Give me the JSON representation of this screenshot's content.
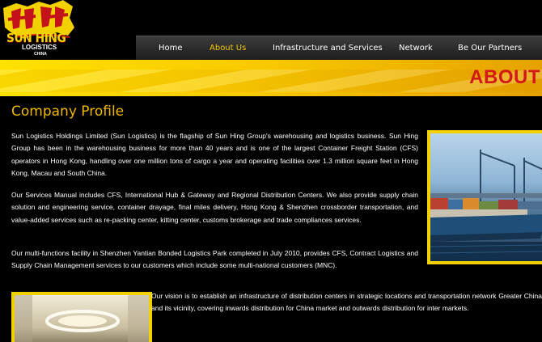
{
  "logo": {
    "chinese": "新興",
    "title": "SUN HING",
    "subtitle": "LOGISTICS",
    "subtitle2": "CHINA"
  },
  "nav": {
    "items": [
      {
        "label": "Home"
      },
      {
        "label": "About Us",
        "active": true
      },
      {
        "label": "Infrastructure and Services"
      },
      {
        "label": "Network"
      },
      {
        "label": "Be Our Partners"
      }
    ]
  },
  "banner": {
    "text": "ABOUT"
  },
  "page": {
    "title": "Company Profile",
    "paragraphs": [
      "Sun Logistics Holdings Limited (Sun Logistics) is the flagship of Sun Hing Group's warehousing and logistics business. Sun Hing Group has been in the warehousing business for more than 40 years and is one of the largest Container Freight Station (CFS) operators in Hong Kong, handling over one million tons of cargo a year and operating facilities over 1.3 million square feet in Hong Kong, Macau and South China.",
      "Our Services Manual includes CFS, International Hub & Gateway and Regional Distribution Centers. We also provide supply chain solution and engineering service, container drayage, final miles delivery, Hong Kong & Shenzhen crossborder transportation, and value-added services such as re-packing center, kitting center, customs brokerage and trade compliances services.",
      "Our multi-functions facility in Shenzhen Yantian Bonded Logistics Park completed in July 2010, provides CFS, Contract Logistics and Supply Chain Management services to our customers which include some multi-national customers (MNC).",
      "Our vision is to establish an infrastructure of distribution centers in strategic locations and transportation network Greater China and its vicinity, covering inwards distribution for China market and outwards distribution for inter markets."
    ]
  },
  "colors": {
    "nav_active": "#f7c800",
    "title": "#f0b800",
    "banner_text": "#d31818",
    "frame": "#f2d100"
  }
}
